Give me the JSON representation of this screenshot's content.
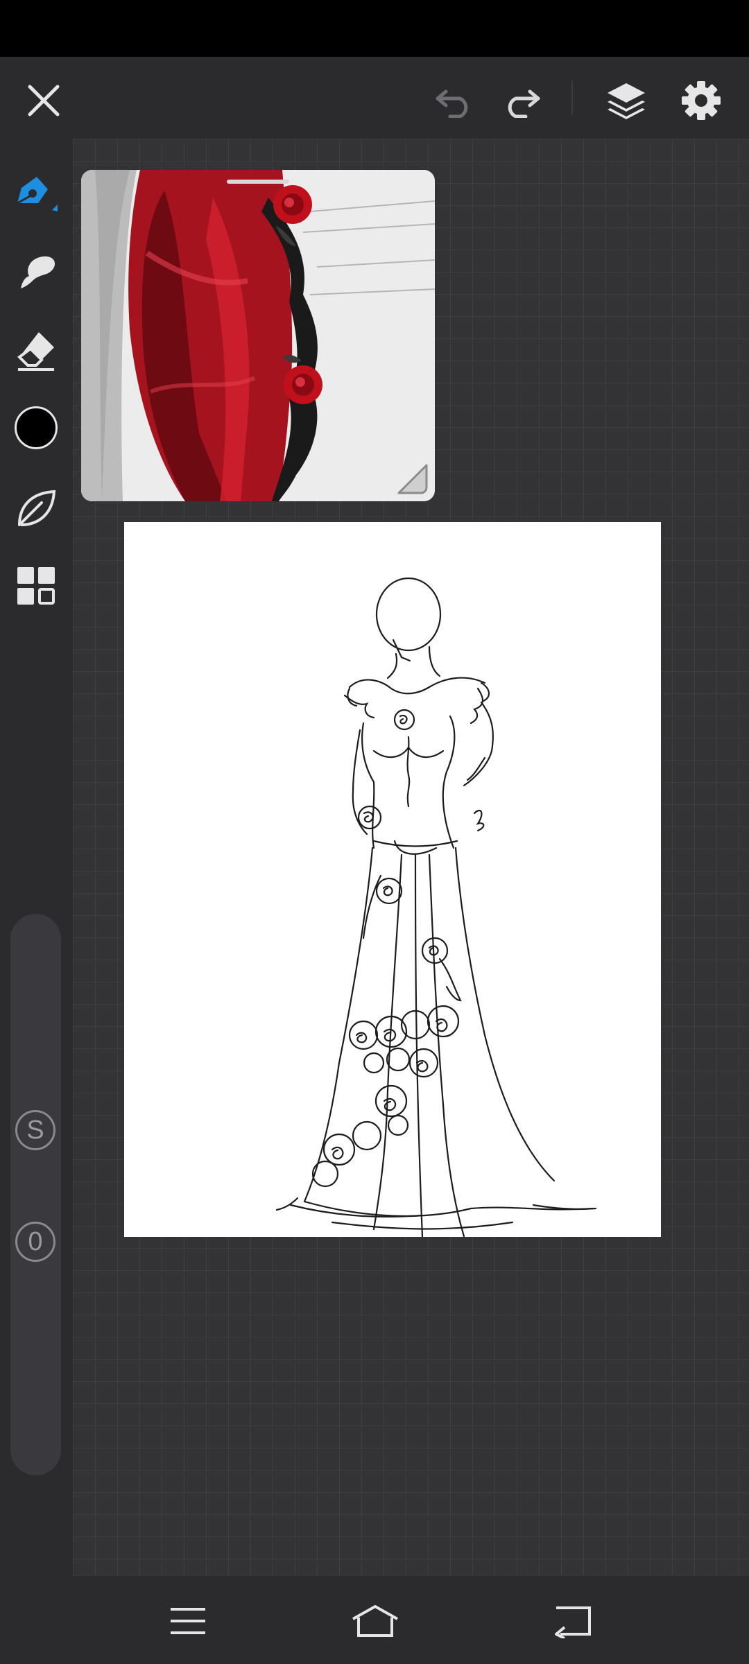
{
  "toolbar": {
    "close_icon": "close-icon",
    "undo_icon": "undo-icon",
    "redo_icon": "redo-icon",
    "layers_icon": "layers-icon",
    "settings_icon": "gear-icon"
  },
  "tools": [
    {
      "name": "pen",
      "icon": "pen-icon",
      "active": true
    },
    {
      "name": "smudge",
      "icon": "smudge-icon"
    },
    {
      "name": "eraser",
      "icon": "eraser-icon"
    },
    {
      "name": "color",
      "icon": "color-swatch",
      "value": "#000000"
    },
    {
      "name": "brush-library",
      "icon": "leaf-icon"
    },
    {
      "name": "more",
      "icon": "grid-icon"
    }
  ],
  "size_indicator": "S",
  "opacity_indicator": "0",
  "colors": {
    "accent": "#1e8fe0",
    "background": "#2a2a2d",
    "rose_red": "#b8101c"
  },
  "navigation": {
    "menu_icon": "menu-icon",
    "home_icon": "home-icon",
    "back_icon": "back-icon"
  }
}
